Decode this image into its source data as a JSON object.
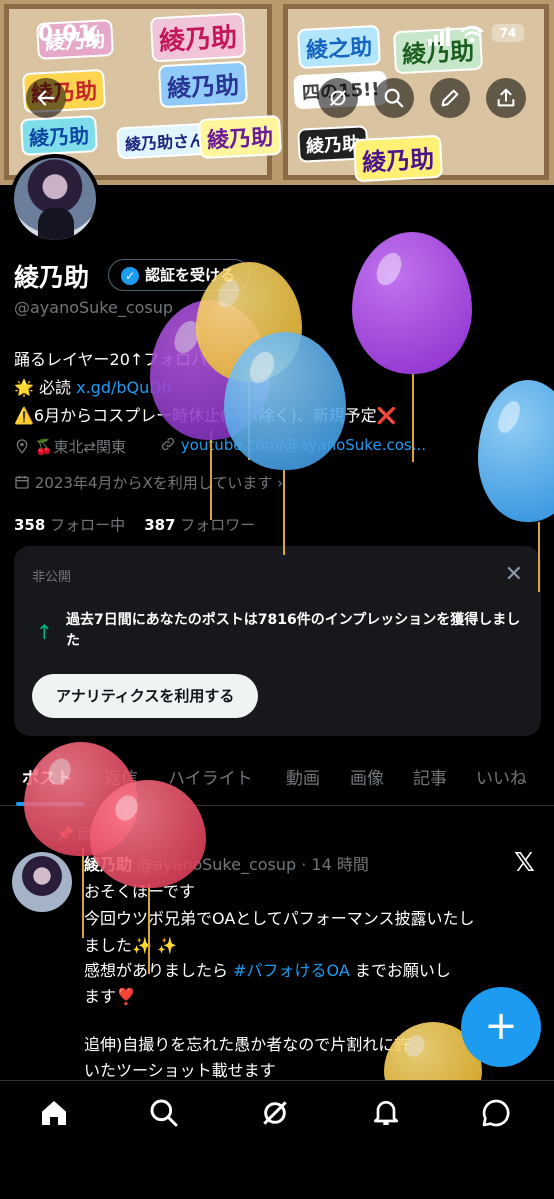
{
  "status_bar": {
    "time": "0:01",
    "battery": "74"
  },
  "banner": {
    "stickers": [
      "綾乃助",
      "綾乃助",
      "綾乃助",
      "綾乃助",
      "綾乃助",
      "綾乃助さん",
      "綾乃助",
      "綾之助",
      "綾乃助",
      "四の15!!",
      "綾乃助",
      "綾乃助"
    ]
  },
  "profile": {
    "name": "綾乃助",
    "verify_button": "認証を受ける",
    "handle": "@ayanoSuke_cosup",
    "bio_line1": "踊るレイヤー20↑フォロバ",
    "bio_line2_prefix": "🌟 必読 ",
    "bio_link": "x.gd/bQuDb",
    "bio_line3": "⚠️6月からコスプレー時休止(イベ除く)、新規予定❌",
    "location": "🍒東北⇄関東",
    "website": "youtube.com/@ayanoSuke.cos...",
    "joined": "2023年4月からXを利用しています",
    "following_count": "358",
    "following_label": "フォロー中",
    "followers_count": "387",
    "followers_label": "フォロワー"
  },
  "analytics_card": {
    "label": "非公開",
    "text": "過去7日間にあなたのポストは7816件のインプレッションを獲得しました",
    "button": "アナリティクスを利用する"
  },
  "tabs": [
    "ポスト",
    "返信",
    "ハイライト",
    "動画",
    "画像",
    "記事",
    "いいね"
  ],
  "post": {
    "pinned_label": "固定",
    "author": "綾乃助",
    "handle_time": "@ayanoSuke_cosup · 14 時間",
    "line1": "おそくほーです",
    "line2": "今回ウツボ兄弟でOAとしてパフォーマンス披露いたし",
    "line3": "ました✨ ✨",
    "line4_prefix": "感想がありましたら ",
    "hashtag": "#パフォけるOA",
    "line4_suffix": " までお願いし",
    "line5": "ます❣️",
    "line6": "追伸)自撮りを忘れた愚か者なので片割れに許",
    "line7": "いたツーショット載せます"
  },
  "fab": "+",
  "colors": {
    "accent": "#1d9bf0",
    "background": "#000000",
    "green": "#00ba7c"
  }
}
